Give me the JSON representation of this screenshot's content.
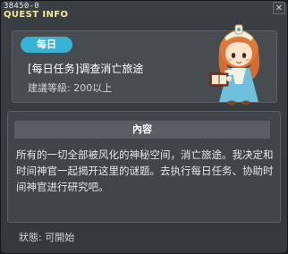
{
  "window": {
    "quest_id": "38450-0",
    "title": "QUEST INFO",
    "close_icon": "close-icon"
  },
  "quest": {
    "badge": "每日",
    "title": "[每日任务]调查消亡旅途",
    "requirement": "建議等級: 200以上",
    "npc_icon": "npc-portrait-girl-with-book"
  },
  "content": {
    "header": "內容",
    "description": "所有的一切全部被风化的神秘空间，消亡旅途。我决定和时间神官一起揭开这里的谜题。去执行每日任务、协助时间神官进行研究吧。"
  },
  "status": {
    "text": "狀態:  可開始"
  },
  "colors": {
    "badge": "#36b3d3",
    "title_text": "#f3e79a",
    "panel": "#474c51"
  }
}
